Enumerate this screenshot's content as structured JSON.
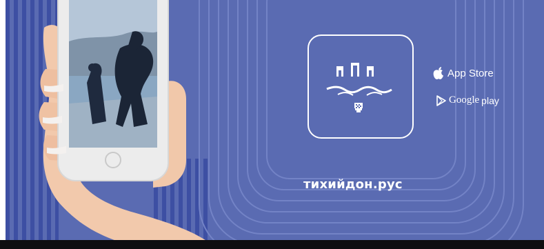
{
  "colors": {
    "background": "#5a6bb2",
    "frame_lines": "#7383c6",
    "stripe_dark": "#3d4fa3",
    "text": "#ffffff",
    "bottom_bar": "#0e0e10"
  },
  "logo": {
    "name": "city-logo",
    "icon": "castle-towers-river-logo"
  },
  "stores": [
    {
      "icon": "apple-icon",
      "label": "App Store"
    },
    {
      "icon": "google-play-icon",
      "label_main": "Google",
      "label_suffix": "play"
    }
  ],
  "website": "тихийдон.рус",
  "phone": {
    "illustration": "hand-holding-smartphone",
    "screen_image": "bronze-statue-photo"
  }
}
